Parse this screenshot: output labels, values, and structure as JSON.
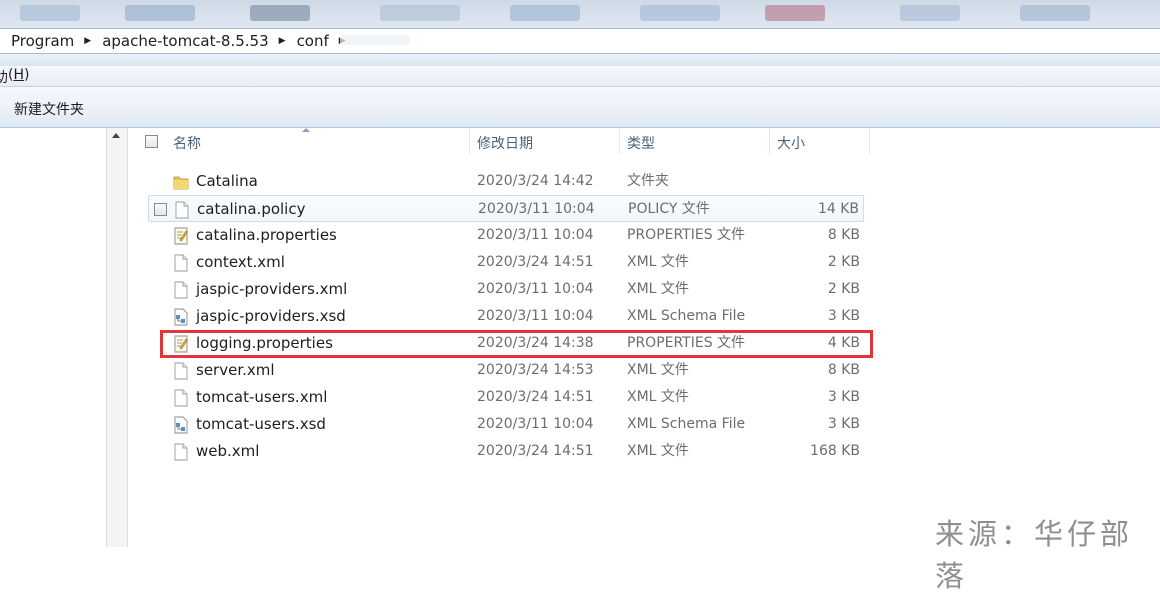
{
  "breadcrumb": {
    "items": [
      "Program",
      "apache-tomcat-8.5.53",
      "conf"
    ]
  },
  "menu": {
    "partial_label": "助",
    "accel": "H"
  },
  "toolbar": {
    "new_folder_label": "新建文件夹"
  },
  "columns": {
    "name": "名称",
    "date": "修改日期",
    "type": "类型",
    "size": "大小"
  },
  "files": [
    {
      "name": "Catalina",
      "date": "2020/3/24 14:42",
      "type": "文件夹",
      "size": "",
      "icon": "folder-icon"
    },
    {
      "name": "catalina.policy",
      "date": "2020/3/11 10:04",
      "type": "POLICY 文件",
      "size": "14 KB",
      "icon": "file-icon"
    },
    {
      "name": "catalina.properties",
      "date": "2020/3/11 10:04",
      "type": "PROPERTIES 文件",
      "size": "8 KB",
      "icon": "properties-file-icon"
    },
    {
      "name": "context.xml",
      "date": "2020/3/24 14:51",
      "type": "XML 文件",
      "size": "2 KB",
      "icon": "file-icon"
    },
    {
      "name": "jaspic-providers.xml",
      "date": "2020/3/11 10:04",
      "type": "XML 文件",
      "size": "2 KB",
      "icon": "file-icon"
    },
    {
      "name": "jaspic-providers.xsd",
      "date": "2020/3/11 10:04",
      "type": "XML Schema File",
      "size": "3 KB",
      "icon": "xsd-file-icon"
    },
    {
      "name": "logging.properties",
      "date": "2020/3/24 14:38",
      "type": "PROPERTIES 文件",
      "size": "4 KB",
      "icon": "properties-file-icon"
    },
    {
      "name": "server.xml",
      "date": "2020/3/24 14:53",
      "type": "XML 文件",
      "size": "8 KB",
      "icon": "file-icon"
    },
    {
      "name": "tomcat-users.xml",
      "date": "2020/3/24 14:51",
      "type": "XML 文件",
      "size": "3 KB",
      "icon": "file-icon"
    },
    {
      "name": "tomcat-users.xsd",
      "date": "2020/3/11 10:04",
      "type": "XML Schema File",
      "size": "3 KB",
      "icon": "xsd-file-icon"
    },
    {
      "name": "web.xml",
      "date": "2020/3/24 14:51",
      "type": "XML 文件",
      "size": "168 KB",
      "icon": "file-icon"
    }
  ],
  "watermark": "来源：华仔部落",
  "colors": {
    "highlight": "#e0353a",
    "header_text": "#4c607a",
    "hover_row_border": "#c9dcf2"
  }
}
